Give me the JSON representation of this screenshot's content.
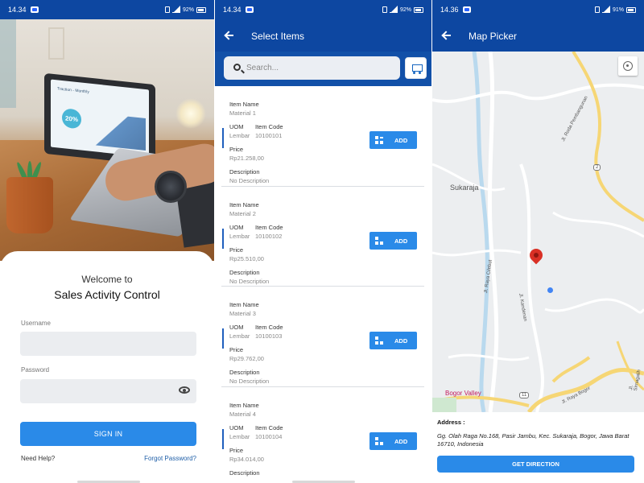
{
  "login": {
    "status_time": "14.34",
    "status_battery": "92%",
    "welcome": "Welcome to",
    "app_name": "Sales Activity Control",
    "username_label": "Username",
    "password_label": "Password",
    "signin_label": "SIGN IN",
    "need_help": "Need Help?",
    "forgot_password": "Forgot Password?",
    "hero": {
      "screen_title": "Traction - Monthly",
      "badge": "20%"
    }
  },
  "items": {
    "status_time": "14.34",
    "status_battery": "92%",
    "title": "Select Items",
    "search_placeholder": "Search...",
    "labels": {
      "item_name": "Item Name",
      "uom": "UOM",
      "item_code": "Item Code",
      "price": "Price",
      "description": "Description",
      "add": "ADD"
    },
    "list": [
      {
        "name": "Material 1",
        "uom": "Lembar",
        "code": "10100101",
        "price": "Rp21.258,00",
        "description": "No Description"
      },
      {
        "name": "Material 2",
        "uom": "Lembar",
        "code": "10100102",
        "price": "Rp25.510,00",
        "description": "No Description"
      },
      {
        "name": "Material 3",
        "uom": "Lembar",
        "code": "10100103",
        "price": "Rp29.762,00",
        "description": "No Description"
      },
      {
        "name": "Material 4",
        "uom": "Lembar",
        "code": "10100104",
        "price": "Rp34.014,00",
        "description": ""
      }
    ]
  },
  "map": {
    "status_time": "14.36",
    "status_battery": "91%",
    "title": "Map Picker",
    "labels": {
      "sukaraja": "Sukaraja",
      "bogor_valley": "Bogor Valley",
      "road_number": "11",
      "road_number_2": "2",
      "jl_raya_cilebut": "Jl. Raya Cilebut",
      "jl_kandenan": "Jl. Kandenan",
      "jl_roda_pembangunan": "Jl. Roda Pembangunan",
      "jl_raya_bogor": "Jl. Raya Bogor",
      "jl_raya_sirnagalih": "Jl. Sirnagalih"
    },
    "address_title": "Address :",
    "address_text": "Gg. Olah Raga No.168, Pasir Jambu, Kec. Sukaraja, Bogor, Jawa Barat 16710, Indonesia",
    "direction_label": "GET DIRECTION"
  },
  "colors": {
    "app_bar": "#0d47a1",
    "primary_button": "#2a8ae8",
    "pin": "#d93025"
  }
}
